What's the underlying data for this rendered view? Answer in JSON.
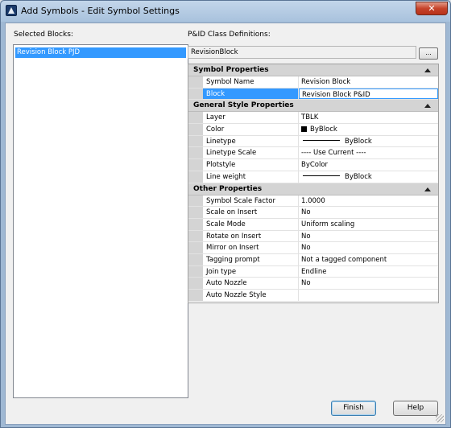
{
  "window": {
    "title": "Add Symbols - Edit Symbol Settings",
    "close_glyph": "✕"
  },
  "selected_blocks": {
    "label": "Selected Blocks:",
    "items": [
      "Revision Block PJD"
    ]
  },
  "class_definitions": {
    "label": "P&ID Class Definitions:",
    "value": "RevisionBlock",
    "browse_label": "..."
  },
  "property_grid": {
    "symbol_properties": {
      "title": "Symbol Properties",
      "rows": [
        {
          "name": "Symbol Name",
          "value": "Revision Block"
        },
        {
          "name": "Block",
          "value": "Revision Block P&ID"
        }
      ]
    },
    "general_style": {
      "title": "General Style Properties",
      "rows": [
        {
          "name": "Layer",
          "value": "TBLK"
        },
        {
          "name": "Color",
          "value": "ByBlock"
        },
        {
          "name": "Linetype",
          "value": "ByBlock"
        },
        {
          "name": "Linetype Scale",
          "value": "---- Use Current ----"
        },
        {
          "name": "Plotstyle",
          "value": "ByColor"
        },
        {
          "name": "Line weight",
          "value": "ByBlock"
        }
      ]
    },
    "other_properties": {
      "title": "Other Properties",
      "rows": [
        {
          "name": "Symbol Scale Factor",
          "value": "1.0000"
        },
        {
          "name": "Scale on Insert",
          "value": "No"
        },
        {
          "name": "Scale Mode",
          "value": "Uniform scaling"
        },
        {
          "name": "Rotate on Insert",
          "value": "No"
        },
        {
          "name": "Mirror on Insert",
          "value": "No"
        },
        {
          "name": "Tagging prompt",
          "value": "Not a tagged component"
        },
        {
          "name": "Join type",
          "value": "Endline"
        },
        {
          "name": "Auto Nozzle",
          "value": "No"
        },
        {
          "name": "Auto Nozzle Style",
          "value": ""
        }
      ]
    }
  },
  "buttons": {
    "finish": "Finish",
    "help": "Help"
  },
  "colors": {
    "selection": "#3399ff",
    "category_bg": "#d4d4d4",
    "close_button": "#c6432a"
  }
}
